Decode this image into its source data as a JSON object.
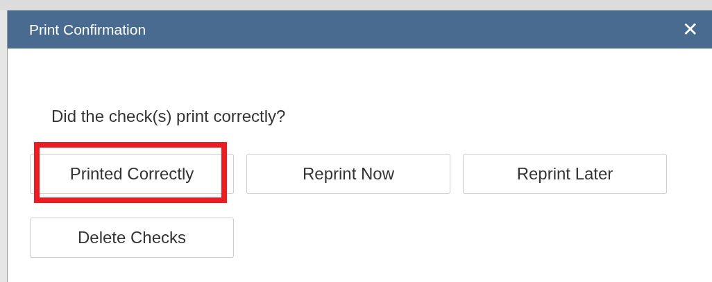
{
  "dialog": {
    "title": "Print Confirmation",
    "close": "✕",
    "message": "Did the check(s) print correctly?",
    "buttons": [
      {
        "label": "Printed Correctly",
        "highlighted": true
      },
      {
        "label": "Reprint Now",
        "highlighted": false
      },
      {
        "label": "Reprint Later",
        "highlighted": false
      },
      {
        "label": "Delete Checks",
        "highlighted": false
      }
    ]
  }
}
